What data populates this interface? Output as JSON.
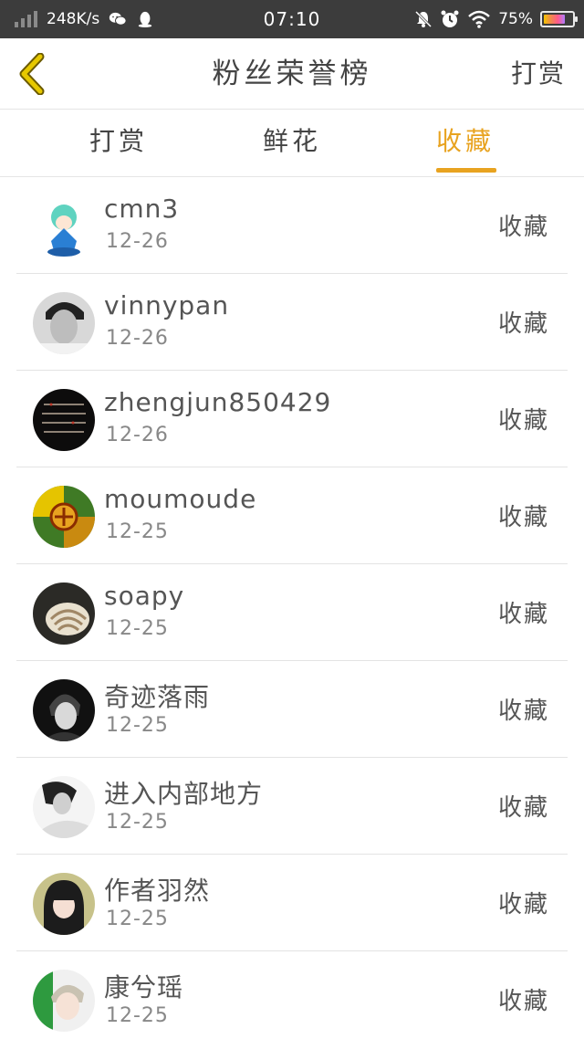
{
  "status_bar": {
    "network_speed": "248K/s",
    "time": "07:10",
    "battery": "75%",
    "battery_level": 0.75
  },
  "header": {
    "title": "粉丝荣誉榜",
    "right_label": "打赏"
  },
  "tabs": [
    {
      "label": "打赏",
      "active": false
    },
    {
      "label": "鲜花",
      "active": false
    },
    {
      "label": "收藏",
      "active": true
    }
  ],
  "colors": {
    "accent": "#e8a320",
    "back_arrow": "#e6c800",
    "status_bar": "#3c3c3c"
  },
  "fans": [
    {
      "name": "cmn3",
      "date": "12-26",
      "action": "收藏"
    },
    {
      "name": "vinnypan",
      "date": "12-26",
      "action": "收藏"
    },
    {
      "name": "zhengjun850429",
      "date": "12-26",
      "action": "收藏"
    },
    {
      "name": "moumoude",
      "date": "12-25",
      "action": "收藏"
    },
    {
      "name": "soapy",
      "date": "12-25",
      "action": "收藏"
    },
    {
      "name": "奇迹落雨",
      "date": "12-25",
      "action": "收藏"
    },
    {
      "name": "进入内部地方",
      "date": "12-25",
      "action": "收藏"
    },
    {
      "name": "作者羽然",
      "date": "12-25",
      "action": "收藏"
    },
    {
      "name": "康兮瑶",
      "date": "12-25",
      "action": "收藏"
    }
  ]
}
